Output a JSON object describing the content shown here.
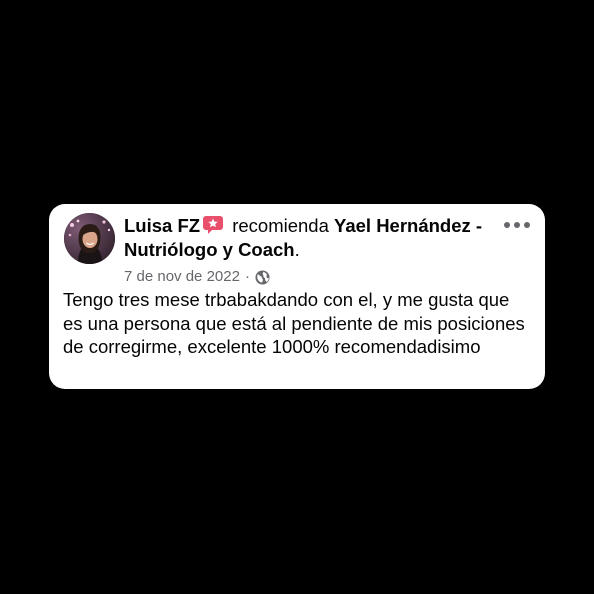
{
  "post": {
    "author_name": "Luisa FZ",
    "recommend_icon": "recommendation-star-icon",
    "verb": "recomienda",
    "page_name": "Yael Hernández - Nutriólogo y Coach",
    "page_name_suffix": ".",
    "date": "7 de nov de 2022",
    "separator": "·",
    "audience_icon": "globe-icon",
    "more_icon": "more-options-icon",
    "text": "Tengo tres mese trbabakdando con el, y me gusta que es una persona que está al pendiente de mis posiciones de corregirme, excelente 1000% recomendadisimo"
  },
  "colors": {
    "background": "#000000",
    "card": "#ffffff",
    "text_primary": "#050505",
    "text_secondary": "#65676b",
    "badge": "#e94e6a"
  }
}
